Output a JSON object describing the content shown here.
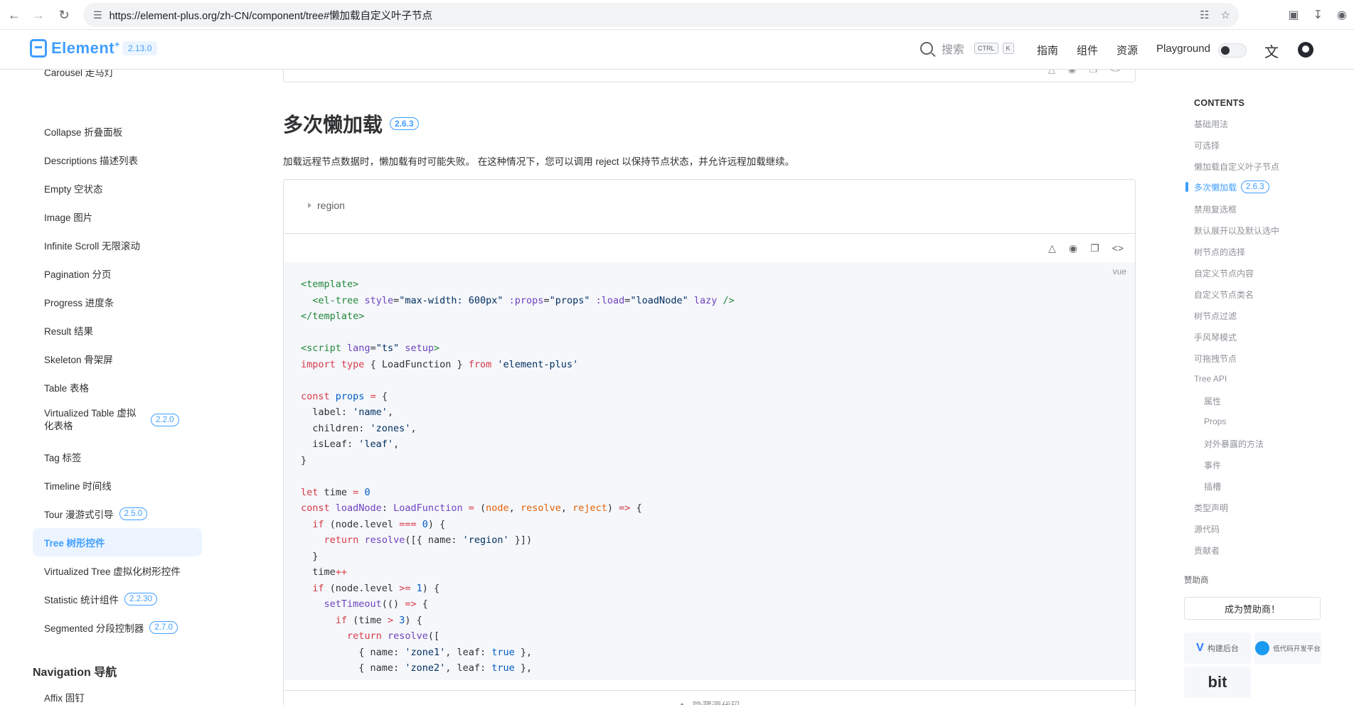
{
  "browser": {
    "url": "https://element-plus.org/zh-CN/component/tree#懒加载自定义叶子节点"
  },
  "header": {
    "logo_text": "Element",
    "logo_sup": "+",
    "version": "2.13.0",
    "search_placeholder": "搜索",
    "kbd_ctrl": "CTRL",
    "kbd_k": "K",
    "nav": [
      "指南",
      "组件",
      "资源",
      "Playground"
    ]
  },
  "sidebar": {
    "items": [
      {
        "label": "Carousel 走马灯",
        "badge": ""
      },
      {
        "label": "Collapse 折叠面板",
        "badge": ""
      },
      {
        "label": "Descriptions 描述列表",
        "badge": ""
      },
      {
        "label": "Empty 空状态",
        "badge": ""
      },
      {
        "label": "Image 图片",
        "badge": ""
      },
      {
        "label": "Infinite Scroll 无限滚动",
        "badge": ""
      },
      {
        "label": "Pagination 分页",
        "badge": ""
      },
      {
        "label": "Progress 进度条",
        "badge": ""
      },
      {
        "label": "Result 结果",
        "badge": ""
      },
      {
        "label": "Skeleton 骨架屏",
        "badge": ""
      },
      {
        "label": "Table 表格",
        "badge": ""
      },
      {
        "label": "Virtualized Table 虚拟化表格",
        "badge": "2.2.0"
      },
      {
        "label": "Tag 标签",
        "badge": ""
      },
      {
        "label": "Timeline 时间线",
        "badge": ""
      },
      {
        "label": "Tour 漫游式引导",
        "badge": "2.5.0"
      },
      {
        "label": "Tree 树形控件",
        "badge": "",
        "active": true
      },
      {
        "label": "Virtualized Tree 虚拟化树形控件",
        "badge": ""
      },
      {
        "label": "Statistic 统计组件",
        "badge": "2.2.30"
      },
      {
        "label": "Segmented 分段控制器",
        "badge": "2.7.0"
      }
    ],
    "group_navigation": "Navigation 导航",
    "affix": "Affix 固钉"
  },
  "main": {
    "section_title": "多次懒加载",
    "section_badge": "2.6.3",
    "description": "加载远程节点数据时，懒加载有时可能失败。 在这种情况下，您可以调用 reject 以保持节点状态，并允许远程加载继续。",
    "tree_node": "region",
    "code_lang": "vue",
    "hide_code": "隐藏源代码"
  },
  "toc": {
    "title": "CONTENTS",
    "items": [
      {
        "label": "基础用法",
        "sub": false
      },
      {
        "label": "可选择",
        "sub": false
      },
      {
        "label": "懒加载自定义叶子节点",
        "sub": false
      },
      {
        "label": "多次懒加载",
        "sub": false,
        "active": true,
        "badge": "2.6.3"
      },
      {
        "label": "禁用复选框",
        "sub": false
      },
      {
        "label": "默认展开以及默认选中",
        "sub": false
      },
      {
        "label": "树节点的选择",
        "sub": false
      },
      {
        "label": "自定义节点内容",
        "sub": false
      },
      {
        "label": "自定义节点类名",
        "sub": false
      },
      {
        "label": "树节点过滤",
        "sub": false
      },
      {
        "label": "手风琴模式",
        "sub": false
      },
      {
        "label": "可拖拽节点",
        "sub": false
      },
      {
        "label": "Tree API",
        "sub": false
      },
      {
        "label": "属性",
        "sub": true
      },
      {
        "label": "Props",
        "sub": true
      },
      {
        "label": "对外暴露的方法",
        "sub": true
      },
      {
        "label": "事件",
        "sub": true
      },
      {
        "label": "插槽",
        "sub": true
      },
      {
        "label": "类型声明",
        "sub": false
      },
      {
        "label": "源代码",
        "sub": false
      },
      {
        "label": "贡献者",
        "sub": false
      }
    ],
    "sponsor_label": "赞助商",
    "sponsor_button": "成为赞助商！",
    "sponsor_1": "构建后台",
    "sponsor_2": "低代码开发平台",
    "sponsor_3": "bit"
  },
  "colors": {
    "accent": "#409eff",
    "active_bg": "#ecf5ff"
  }
}
